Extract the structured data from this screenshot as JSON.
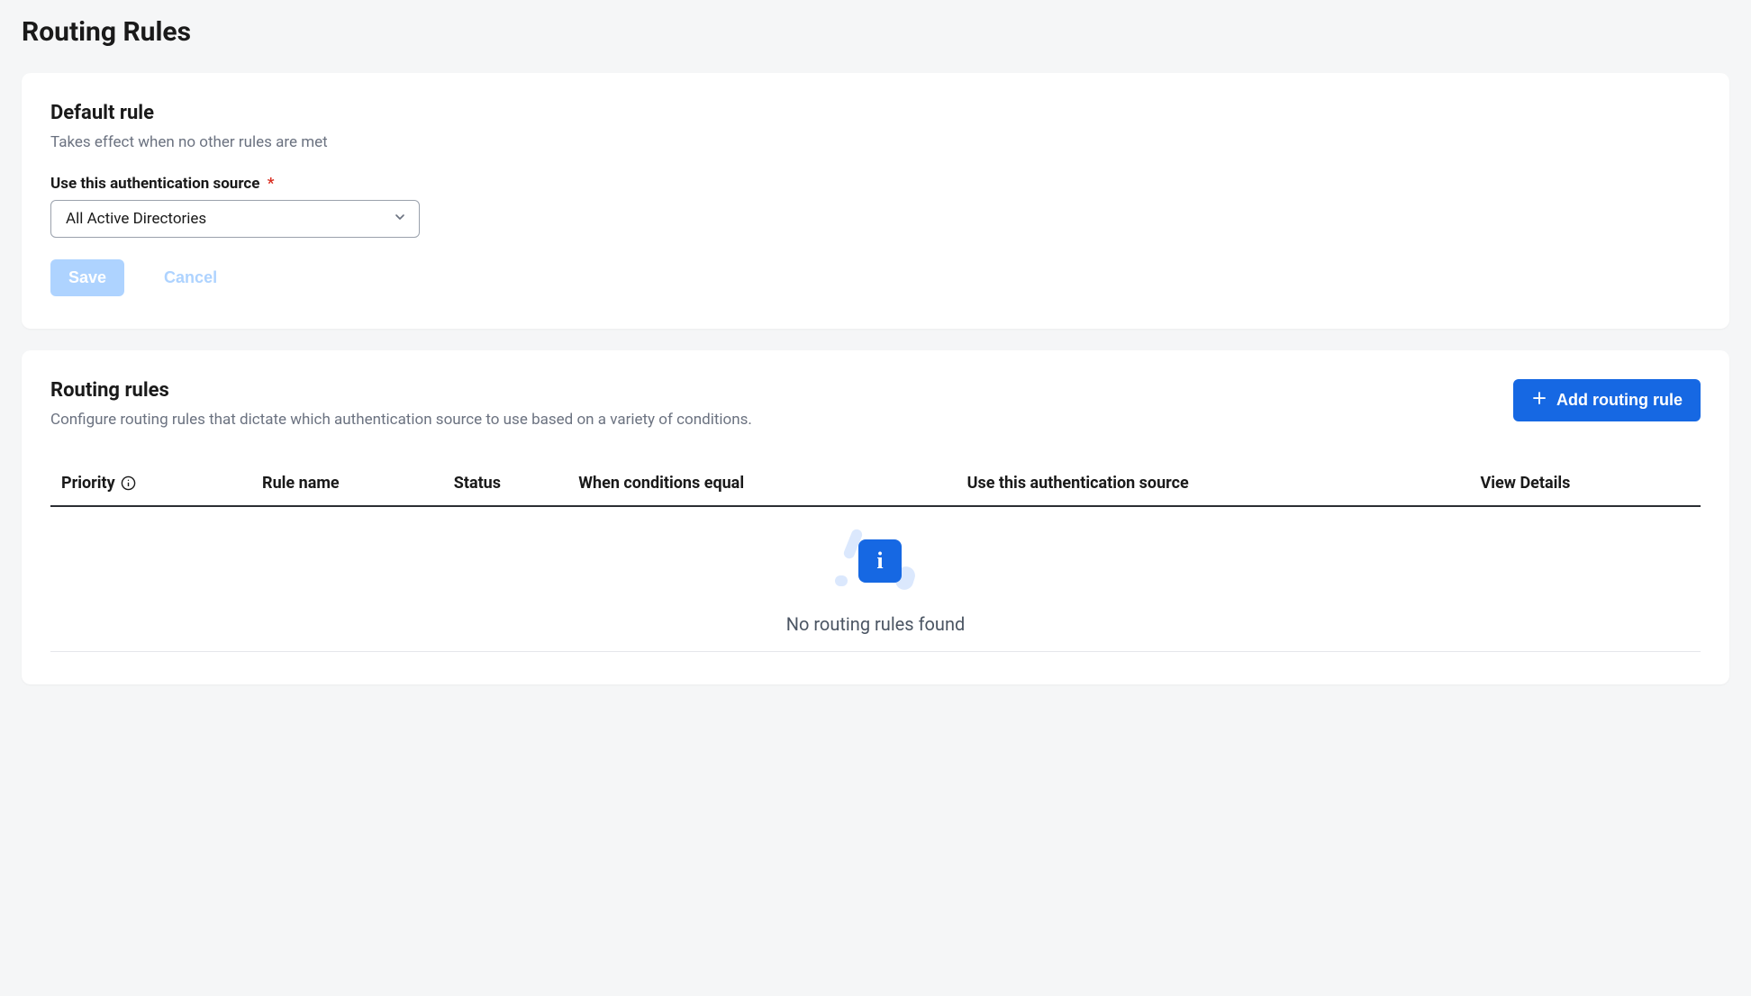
{
  "page": {
    "title": "Routing Rules"
  },
  "default_rule_card": {
    "title": "Default rule",
    "subtitle": "Takes effect when no other rules are met",
    "auth_source_label": "Use this authentication source",
    "required_marker": "*",
    "auth_source_selected": "All Active Directories",
    "save_label": "Save",
    "cancel_label": "Cancel"
  },
  "rules_card": {
    "title": "Routing rules",
    "subtitle": "Configure routing rules that dictate which authentication source to use based on a variety of conditions.",
    "add_button_label": "Add routing rule",
    "columns": {
      "priority": "Priority",
      "rule_name": "Rule name",
      "status": "Status",
      "conditions": "When conditions equal",
      "auth_source": "Use this authentication source",
      "view_details": "View Details"
    },
    "empty_message": "No routing rules found",
    "info_glyph": "i"
  }
}
